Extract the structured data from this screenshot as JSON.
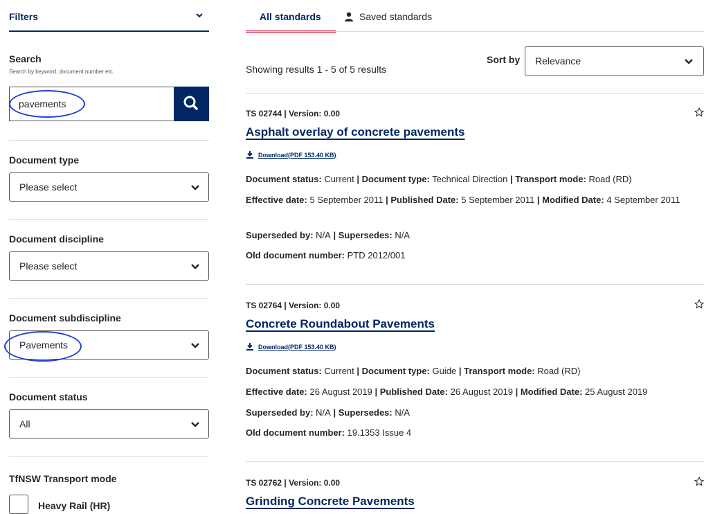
{
  "sidebar": {
    "filters_label": "Filters",
    "search": {
      "title": "Search",
      "subtitle": "Search by keyword, document number etc.",
      "value": "pavements"
    },
    "document_type": {
      "label": "Document type",
      "value": "Please select"
    },
    "document_discipline": {
      "label": "Document discipline",
      "value": "Please select"
    },
    "document_subdiscipline": {
      "label": "Document subdiscipline",
      "value": "Pavements"
    },
    "document_status": {
      "label": "Document status",
      "value": "All"
    },
    "transport_mode": {
      "label": "TfNSW Transport mode",
      "option1": "Heavy Rail (HR)"
    }
  },
  "tabs": {
    "all": "All standards",
    "saved": "Saved standards"
  },
  "results": {
    "count_text": "Showing results 1 - 5 of 5 results",
    "sort_label": "Sort by",
    "sort_value": "Relevance"
  },
  "labels": {
    "status": "Document status:",
    "type": "Document type:",
    "mode": "Transport mode:",
    "effective": "Effective date:",
    "published": "Published Date:",
    "modified": "Modified Date:",
    "superseded": "Superseded by:",
    "supersedes": "Supersedes:",
    "old": "Old document number:",
    "sep": " | "
  },
  "cards": [
    {
      "meta": "TS 02744 | Version: 0.00",
      "title": "Asphalt overlay of concrete pavements",
      "download": "Download(PDF 153.40 KB)",
      "status": "Current",
      "type": "Technical Direction",
      "mode": "Road (RD)",
      "effective": "5 September 2011",
      "published": "5 September 2011",
      "modified": "4 September 2011",
      "superseded": "N/A",
      "supersedes": "N/A",
      "old": "PTD 2012/001"
    },
    {
      "meta": "TS 02764 | Version: 0.00",
      "title": "Concrete Roundabout Pavements",
      "download": "Download(PDF 153.40 KB)",
      "status": "Current",
      "type": "Guide",
      "mode": "Road (RD)",
      "effective": "26 August 2019",
      "published": "26 August 2019",
      "modified": "25 August 2019",
      "superseded": "N/A",
      "supersedes": "N/A",
      "old": "19.1353 Issue 4"
    },
    {
      "meta": "TS 02762 | Version: 0.00",
      "title": "Grinding Concrete Pavements"
    }
  ],
  "colors": {
    "navy": "#002664",
    "red": "#d7153a",
    "annotation": "#1f3fd9"
  }
}
